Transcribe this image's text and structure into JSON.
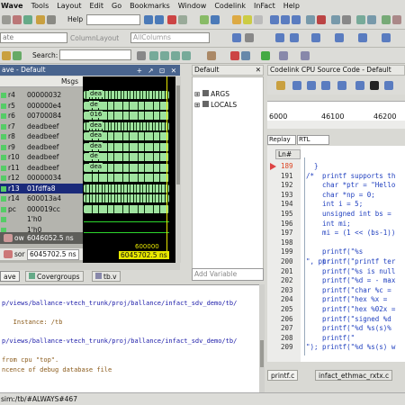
{
  "menu": [
    "Wave",
    "Tools",
    "Layout",
    "Edit",
    "Go",
    "Bookmarks",
    "Window",
    "Codelink",
    "InFact",
    "Help"
  ],
  "toolbar": {
    "help_label": "Help",
    "help_value": "",
    "layout_left": "ate",
    "layout_label": "ColumnLayout",
    "layout_value": "AllColumns",
    "search_label": "Search:"
  },
  "wave": {
    "title": "ave - Default",
    "msgs_label": "Msgs",
    "signals": [
      {
        "name": "r4",
        "value": "00000032"
      },
      {
        "name": "r5",
        "value": "000000e4"
      },
      {
        "name": "r6",
        "value": "00700084"
      },
      {
        "name": "r7",
        "value": "deadbeef"
      },
      {
        "name": "r8",
        "value": "deadbeef"
      },
      {
        "name": "r9",
        "value": "deadbeef"
      },
      {
        "name": "r10",
        "value": "deadbeef"
      },
      {
        "name": "r11",
        "value": "deadbeef"
      },
      {
        "name": "r12",
        "value": "00000034"
      },
      {
        "name": "r13",
        "value": "01fdffa8"
      },
      {
        "name": "r14",
        "value": "600013a4"
      },
      {
        "name": "pc",
        "value": "000019cc"
      },
      {
        "name": "",
        "value": "1'h0"
      },
      {
        "name": "",
        "value": "1'h0"
      }
    ],
    "wave_labels": [
      "dea",
      "de",
      "016",
      "dea",
      "dea",
      "dea",
      "de",
      "dea"
    ],
    "now_label": "ow",
    "now_value": "6046052.5 ns",
    "cursor_label": "sor",
    "cursor_value": "6045702.5 ns",
    "time_marker": "600000",
    "cursor_time": "6045702.5 ns",
    "tabs": [
      "ave",
      "Covergroups",
      "tb.v"
    ]
  },
  "locals": {
    "title": "Default",
    "items": [
      "ARGS",
      "LOCALS"
    ],
    "add_variable": "Add Variable"
  },
  "source": {
    "title": "Codelink CPU Source Code - Default",
    "ruler": [
      "6000",
      "46100",
      "46200"
    ],
    "mode_tabs": [
      "Replay",
      "RTL"
    ],
    "ln_header": "Ln#",
    "lines": [
      {
        "n": "189",
        "t": "  }",
        "cur": true
      },
      {
        "n": "191",
        "t": "/*  printf supports th"
      },
      {
        "n": "192",
        "t": "    char *ptr = \"Hello"
      },
      {
        "n": "193",
        "t": "    char *np = 0;"
      },
      {
        "n": "194",
        "t": "    int i = 5;"
      },
      {
        "n": "195",
        "t": "    unsigned int bs ="
      },
      {
        "n": "196",
        "t": "    int mi;"
      },
      {
        "n": "197",
        "t": "    mi = (1 << (bs-1))"
      },
      {
        "n": "198",
        "t": ""
      },
      {
        "n": "199",
        "t": "    printf(\"%s\n\", ptr"
      },
      {
        "n": "200",
        "t": "    printf(\"printf ter"
      },
      {
        "n": "201",
        "t": "    printf(\"%s is null"
      },
      {
        "n": "202",
        "t": "    printf(\"%d = - max"
      },
      {
        "n": "203",
        "t": "    printf(\"char %c ="
      },
      {
        "n": "204",
        "t": "    printf(\"hex %x = "
      },
      {
        "n": "205",
        "t": "    printf(\"hex %02x ="
      },
      {
        "n": "206",
        "t": "    printf(\"signed %d"
      },
      {
        "n": "207",
        "t": "    printf(\"%d %s(s)%"
      },
      {
        "n": "208",
        "t": "    printf(\"\n\");"
      },
      {
        "n": "209",
        "t": "    printf(\"%d %s(s) w"
      }
    ],
    "file_tabs": [
      "printf.c",
      "infact_ethmac_rxtx.c"
    ]
  },
  "transcript": {
    "lines": [
      {
        "t": "p/views/ballance-vtech_trunk/proj/ballance/infact_sdv_demo/tb/",
        "c": "#1a1aa8"
      },
      {
        "t": "",
        "c": "#222"
      },
      {
        "t": "   Instance: /tb",
        "c": "#8a5a1a"
      },
      {
        "t": "",
        "c": "#222"
      },
      {
        "t": "p/views/ballance-vtech_trunk/proj/ballance/infact_sdv_demo/tb/",
        "c": "#1a1aa8"
      },
      {
        "t": "",
        "c": "#222"
      },
      {
        "t": "from cpu \"top\".",
        "c": "#8a5a1a"
      },
      {
        "t": "ncence of debug database file",
        "c": "#8a5a1a"
      }
    ]
  },
  "status": {
    "text": "sim:/tb/#ALWAYS#467"
  }
}
